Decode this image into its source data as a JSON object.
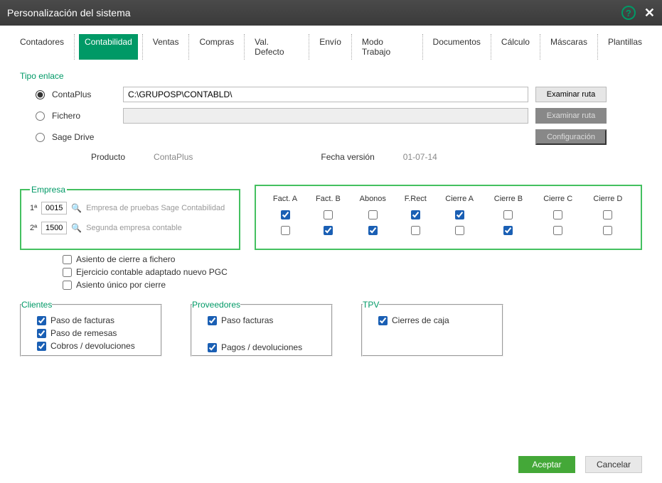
{
  "window": {
    "title": "Personalización del sistema"
  },
  "tabs": {
    "contadores": "Contadores",
    "contabilidad": "Contabilidad",
    "ventas": "Ventas",
    "compras": "Compras",
    "valdefecto": "Val. Defecto",
    "envio": "Envío",
    "modotrabajo": "Modo Trabajo",
    "documentos": "Documentos",
    "calculo": "Cálculo",
    "mascaras": "Máscaras",
    "plantillas": "Plantillas"
  },
  "tipo": {
    "legend": "Tipo enlace",
    "contaplus": "ContaPlus",
    "fichero": "Fichero",
    "sagedrive": "Sage Drive",
    "path_contaplus": "C:\\GRUPOSP\\CONTABLD\\",
    "path_fichero": "",
    "btn_exam": "Examinar ruta",
    "btn_exam_dis": "Examinar ruta",
    "btn_config_dis": "Configuración"
  },
  "info": {
    "producto_label": "Producto",
    "producto_value": "ContaPlus",
    "fecha_label": "Fecha versión",
    "fecha_value": "01-07-14"
  },
  "empresa": {
    "legend": "Empresa",
    "row1_ord": "1ª",
    "row1_code": "0015",
    "row1_name": "Empresa de pruebas Sage Contabilidad",
    "row2_ord": "2ª",
    "row2_code": "1500",
    "row2_name": "Segunda empresa contable"
  },
  "grid": {
    "headers": [
      "Fact. A",
      "Fact. B",
      "Abonos",
      "F.Rect",
      "Cierre A",
      "Cierre B",
      "Cierre C",
      "Cierre D"
    ],
    "row1": [
      true,
      false,
      false,
      true,
      true,
      false,
      false,
      false
    ],
    "row2": [
      false,
      true,
      true,
      false,
      false,
      true,
      false,
      false
    ]
  },
  "chks": {
    "asiento_fichero": "Asiento de cierre a fichero",
    "ejercicio_pgc": "Ejercicio contable adaptado nuevo PGC",
    "asiento_unico": "Asiento único por cierre"
  },
  "clientes": {
    "legend": "Clientes",
    "paso_fact": "Paso de facturas",
    "paso_rem": "Paso de remesas",
    "cobros": "Cobros / devoluciones"
  },
  "proveedores": {
    "legend": "Proveedores",
    "paso_fact": "Paso facturas",
    "pagos": "Pagos / devoluciones"
  },
  "tpv": {
    "legend": "TPV",
    "cierres": "Cierres de caja"
  },
  "footer": {
    "accept": "Aceptar",
    "cancel": "Cancelar"
  }
}
